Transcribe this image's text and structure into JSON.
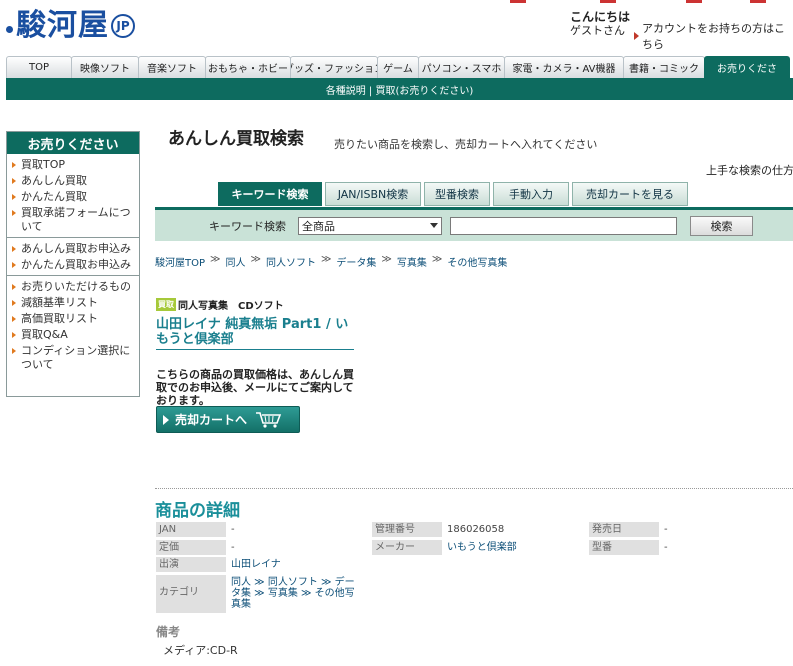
{
  "header": {
    "logo_text": "駿河屋",
    "logo_badge": "JP",
    "greeting": "こんにちは",
    "greeting_sub": "ゲストさん",
    "account_link": "アカウントをお持ちの方はこちら"
  },
  "nav": {
    "tabs": [
      "TOP",
      "映像ソフト",
      "音楽ソフト",
      "おもちゃ・ホビー",
      "グッズ・ファッション",
      "ゲーム",
      "パソコン・スマホ",
      "家電・カメラ・AV機器",
      "書籍・コミック",
      "お売りくださ"
    ],
    "subbar": "各種説明 | 買取(お売りください)"
  },
  "sidebar": {
    "title": "お売りください",
    "groups": [
      [
        "買取TOP",
        "あんしん買取",
        "かんたん買取",
        "買取承諾フォームについて"
      ],
      [
        "あんしん買取お申込み",
        "かんたん買取お申込み"
      ],
      [
        "お売りいただけるもの",
        "減額基準リスト",
        "高価買取リスト",
        "買取Q&A",
        "コンディション選択について"
      ]
    ]
  },
  "main": {
    "title": "あんしん買取検索",
    "subtitle": "売りたい商品を検索し、売却カートへ入れてください",
    "tip": "上手な検索の仕方",
    "search_tabs": [
      "キーワード検索",
      "JAN/ISBN検索",
      "型番検索",
      "手動入力",
      "売却カートを見る"
    ],
    "search_label": "キーワード検索",
    "search_select": "全商品",
    "search_button": "検索",
    "breadcrumb": [
      "駿河屋TOP",
      "同人",
      "同人ソフト",
      "データ集",
      "写真集",
      "その他写真集"
    ]
  },
  "product": {
    "badge": "買取",
    "category": "同人写真集　CDソフト",
    "title": "山田レイナ 純真無垢 Part1 / いもうと倶楽部",
    "note": "こちらの商品の買取価格は、あんしん買取でのお申込後、メールにてご案内しております。",
    "cart_button": "売却カートへ"
  },
  "details": {
    "heading": "商品の詳細",
    "jan_label": "JAN",
    "jan_value": "-",
    "price_label": "定価",
    "price_value": "-",
    "cast_label": "出演",
    "cast_value": "山田レイナ",
    "category_label": "カテゴリ",
    "category_value": "同人 ≫ 同人ソフト ≫ データ集 ≫ 写真集 ≫ その他写真集",
    "mgmt_label": "管理番号",
    "mgmt_value": "186026058",
    "maker_label": "メーカー",
    "maker_value": "いもうと倶楽部",
    "release_label": "発売日",
    "release_value": "-",
    "model_label": "型番",
    "model_value": "-"
  },
  "remarks": {
    "heading": "備考",
    "value": "メディア:CD-R"
  },
  "colors": {
    "brand_green": "#0d6b5f",
    "logo_blue": "#1a4fa0",
    "accent_orange": "#e07a1f"
  }
}
